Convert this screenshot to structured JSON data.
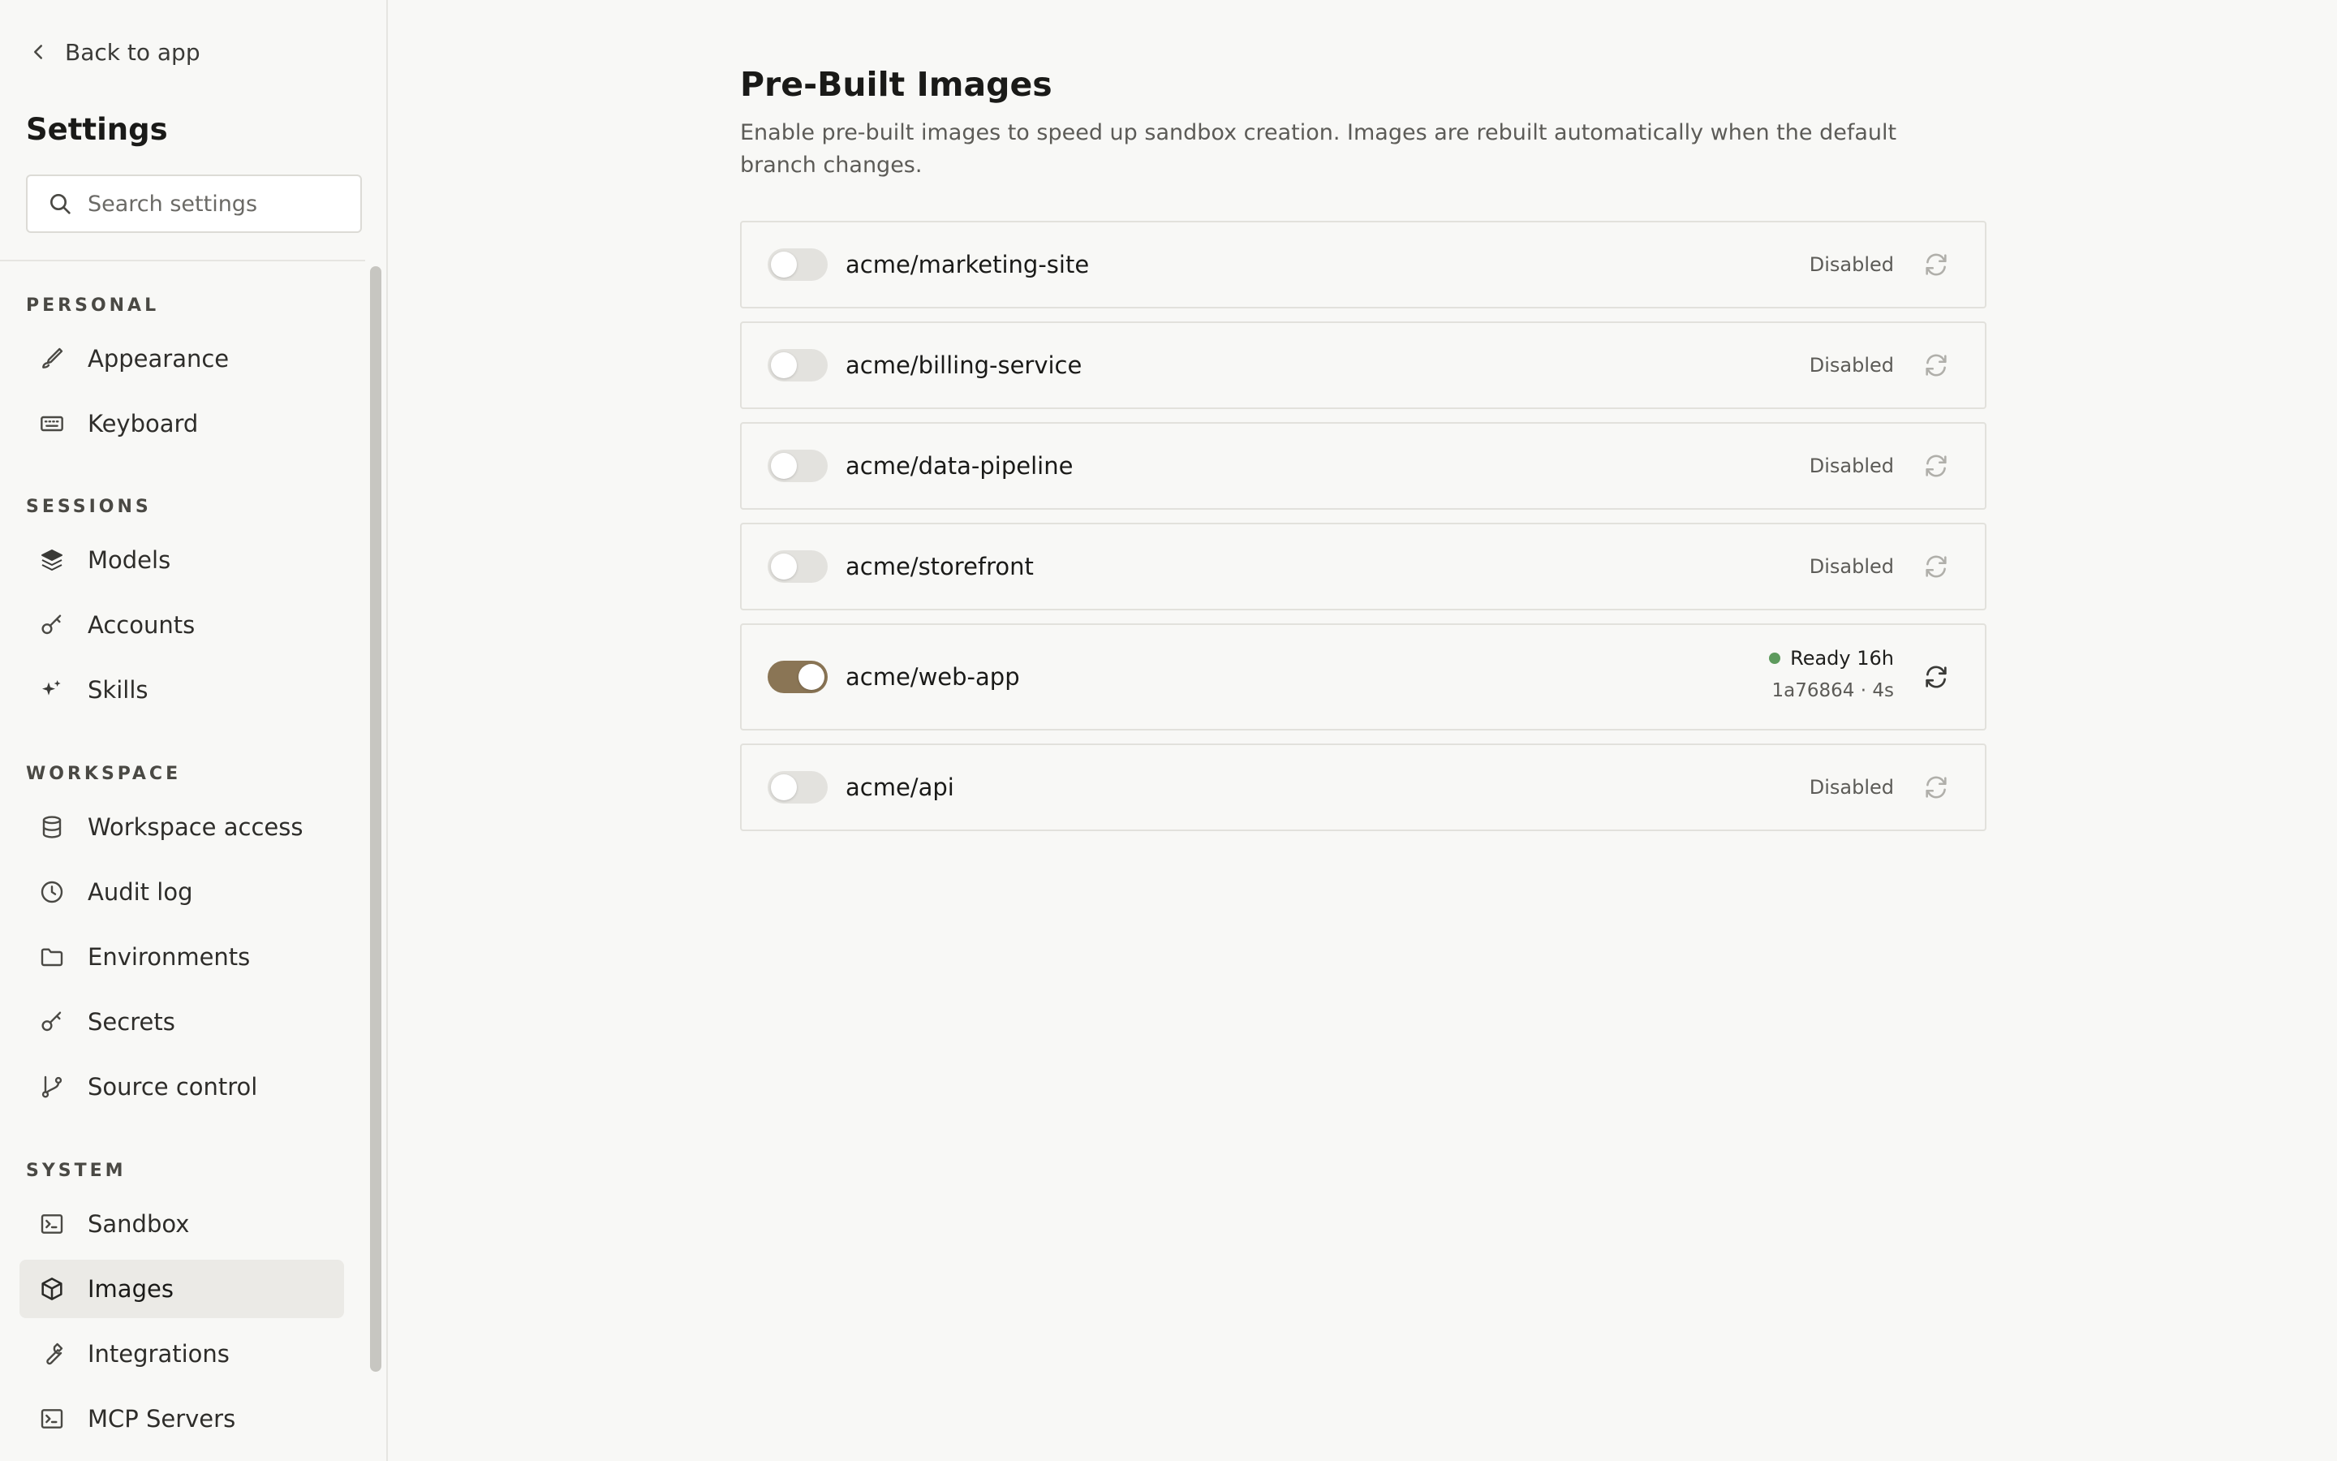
{
  "sidebar": {
    "back_label": "Back to app",
    "title": "Settings",
    "search_placeholder": "Search settings",
    "sections": {
      "personal": {
        "label": "PERSONAL",
        "items": [
          {
            "label": "Appearance",
            "icon": "brush-icon"
          },
          {
            "label": "Keyboard",
            "icon": "keyboard-icon"
          }
        ]
      },
      "sessions": {
        "label": "SESSIONS",
        "items": [
          {
            "label": "Models",
            "icon": "layers-icon"
          },
          {
            "label": "Accounts",
            "icon": "key-icon"
          },
          {
            "label": "Skills",
            "icon": "sparkles-icon"
          }
        ]
      },
      "workspace": {
        "label": "WORKSPACE",
        "items": [
          {
            "label": "Workspace access",
            "icon": "database-icon"
          },
          {
            "label": "Audit log",
            "icon": "clock-icon"
          },
          {
            "label": "Environments",
            "icon": "folder-icon"
          },
          {
            "label": "Secrets",
            "icon": "key-icon"
          },
          {
            "label": "Source control",
            "icon": "git-branch-icon"
          }
        ]
      },
      "system": {
        "label": "SYSTEM",
        "items": [
          {
            "label": "Sandbox",
            "icon": "terminal-icon"
          },
          {
            "label": "Images",
            "icon": "box-icon",
            "active": true
          },
          {
            "label": "Integrations",
            "icon": "wrench-icon"
          },
          {
            "label": "MCP Servers",
            "icon": "terminal-icon"
          }
        ]
      }
    }
  },
  "main": {
    "title": "Pre-Built Images",
    "description": "Enable pre-built images to speed up sandbox creation. Images are rebuilt automatically when the default branch changes.",
    "repos": [
      {
        "name": "acme/marketing-site",
        "enabled": false,
        "status": "Disabled"
      },
      {
        "name": "acme/billing-service",
        "enabled": false,
        "status": "Disabled"
      },
      {
        "name": "acme/data-pipeline",
        "enabled": false,
        "status": "Disabled"
      },
      {
        "name": "acme/storefront",
        "enabled": false,
        "status": "Disabled"
      },
      {
        "name": "acme/web-app",
        "enabled": true,
        "status": "Ready 16h",
        "meta": "1a76864 · 4s"
      },
      {
        "name": "acme/api",
        "enabled": false,
        "status": "Disabled"
      }
    ]
  },
  "colors": {
    "background": "#f8f8f6",
    "toggle_on": "#8a7555",
    "status_ready": "#5d9a5d",
    "active_nav": "#ebeae6"
  }
}
